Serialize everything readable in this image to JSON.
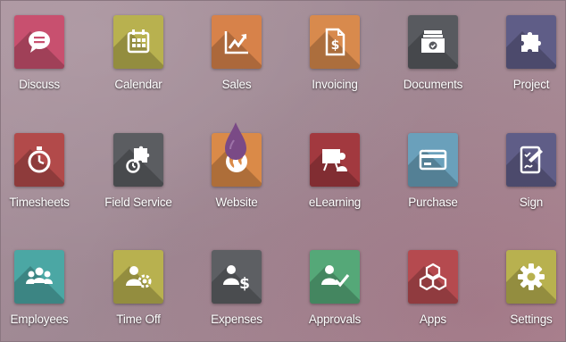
{
  "apps": [
    {
      "label": "Discuss",
      "icon": "chat-bubble-icon",
      "color": "#c8506f"
    },
    {
      "label": "Calendar",
      "icon": "calendar-icon",
      "color": "#b8b14f"
    },
    {
      "label": "Sales",
      "icon": "trend-chart-icon",
      "color": "#d7824a"
    },
    {
      "label": "Invoicing",
      "icon": "invoice-dollar-icon",
      "color": "#d88a4d"
    },
    {
      "label": "Documents",
      "icon": "document-inbox-icon",
      "color": "#585a5f"
    },
    {
      "label": "Project",
      "icon": "puzzle-icon",
      "color": "#5f5d87"
    },
    {
      "label": "Timesheets",
      "icon": "stopwatch-icon",
      "color": "#b24a4a"
    },
    {
      "label": "Field Service",
      "icon": "field-service-icon",
      "color": "#5b5d61"
    },
    {
      "label": "Website",
      "icon": "globe-drop-icon",
      "color": "#da8a48"
    },
    {
      "label": "eLearning",
      "icon": "presentation-icon",
      "color": "#a2393f"
    },
    {
      "label": "Purchase",
      "icon": "credit-card-icon",
      "color": "#6aa0bb"
    },
    {
      "label": "Sign",
      "icon": "sign-tablet-icon",
      "color": "#5f5d87"
    },
    {
      "label": "Employees",
      "icon": "people-icon",
      "color": "#4ba7a4"
    },
    {
      "label": "Time Off",
      "icon": "person-gear-icon",
      "color": "#b8b14f"
    },
    {
      "label": "Expenses",
      "icon": "person-dollar-icon",
      "color": "#5d5f63"
    },
    {
      "label": "Approvals",
      "icon": "person-check-icon",
      "color": "#55a878"
    },
    {
      "label": "Apps",
      "icon": "cubes-icon",
      "color": "#b54a4f"
    },
    {
      "label": "Settings",
      "icon": "gear-icon",
      "color": "#b8b14f"
    }
  ]
}
